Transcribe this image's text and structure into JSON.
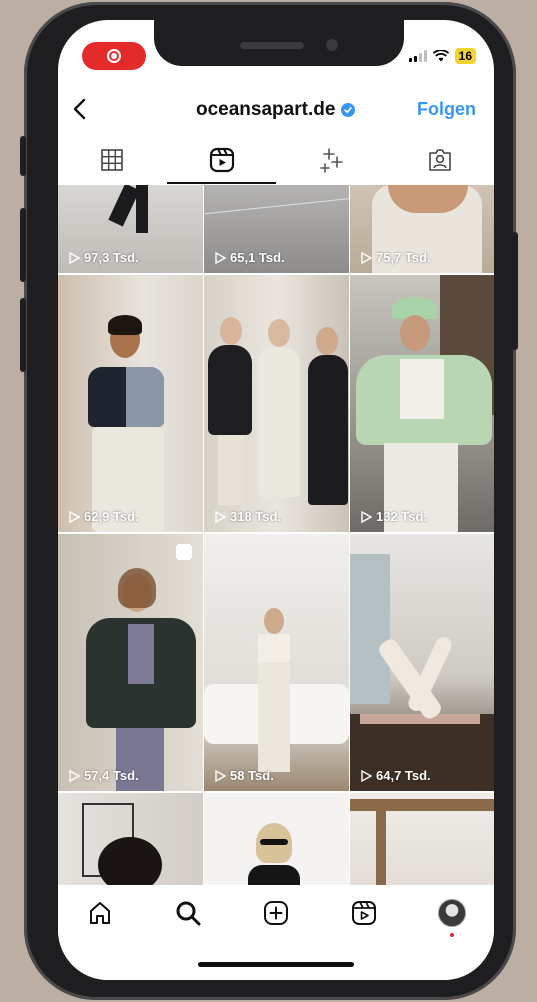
{
  "profile": {
    "username": "oceansapart.de",
    "follow_label": "Folgen"
  },
  "status_bar": {
    "battery": "16"
  },
  "tabs": [
    "grid-icon",
    "reels-icon",
    "sparkles-icon",
    "tagged-icon"
  ],
  "reels": [
    {
      "views": "97,3 Tsd."
    },
    {
      "views": "65,1 Tsd."
    },
    {
      "views": "75,7 Tsd."
    },
    {
      "views": "62,9 Tsd."
    },
    {
      "views": "318 Tsd."
    },
    {
      "views": "132 Tsd."
    },
    {
      "views": "57,4 Tsd."
    },
    {
      "views": "58 Tsd."
    },
    {
      "views": "64,7 Tsd."
    }
  ],
  "bottom_nav": [
    "home-icon",
    "search-icon",
    "create-icon",
    "reels-icon",
    "profile-avatar"
  ],
  "colors": {
    "accent": "#3897f0",
    "record": "#e32b2b",
    "battery": "#f2d22e",
    "background": "#bcaea3"
  }
}
